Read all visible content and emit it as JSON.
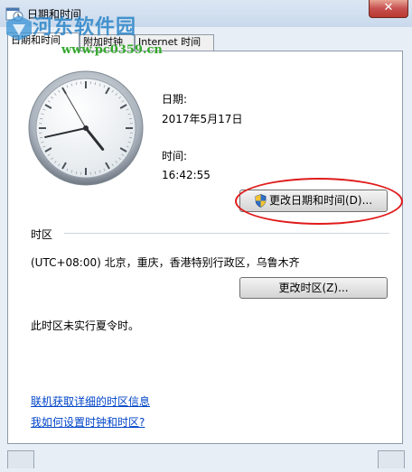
{
  "window": {
    "title": "日期和时间",
    "close_glyph": "✕"
  },
  "watermark": {
    "title": "河东软件园",
    "url": "www.pc0359.cn"
  },
  "tabs": [
    {
      "label": "日期和时间"
    },
    {
      "label": "附加时钟"
    },
    {
      "label": "Internet 时间"
    }
  ],
  "datetime": {
    "date_label": "日期:",
    "date_value": "2017年5月17日",
    "time_label": "时间:",
    "time_value": "16:42:55",
    "change_button": "更改日期和时间(D)...",
    "clock": {
      "hour": 16,
      "minute": 42,
      "second": 55
    }
  },
  "timezone": {
    "section_label": "时区",
    "value": "(UTC+08:00) 北京，重庆，香港特别行政区，乌鲁木齐",
    "change_button": "更改时区(Z)...",
    "dst_note": "此时区未实行夏令时。"
  },
  "links": {
    "online_info": "联机获取详细的时区信息",
    "how_to": "我如何设置时钟和时区?"
  },
  "colors": {
    "link": "#0045c8",
    "highlight": "#e01b1b",
    "close": "#c75050"
  },
  "icons": {
    "title": "calendar-clock-icon",
    "button": "uac-shield-icon",
    "close": "close-icon"
  }
}
